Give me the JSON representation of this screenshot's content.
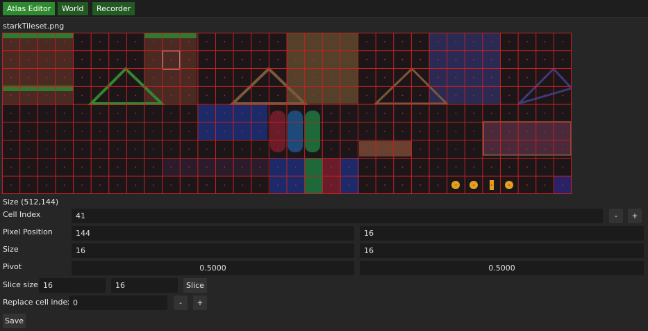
{
  "tabs": [
    {
      "label": "Atlas Editor",
      "active": true
    },
    {
      "label": "World",
      "active": false
    },
    {
      "label": "Recorder",
      "active": false
    }
  ],
  "atlas": {
    "filename": "starkTileset.png",
    "size_label": "Size (512,144)",
    "grid_color": "#c62020",
    "cols": 32,
    "rows": 9
  },
  "cell_index": {
    "label": "Cell Index",
    "value": "41",
    "decrement": "-",
    "increment": "+"
  },
  "pixel_position": {
    "label": "Pixel Position",
    "x": "144",
    "y": "16"
  },
  "size": {
    "label": "Size",
    "w": "16",
    "h": "16"
  },
  "pivot": {
    "label": "Pivot",
    "x": "0.5000",
    "y": "0.5000"
  },
  "slice": {
    "label": "Slice size",
    "w": "16",
    "h": "16",
    "button": "Slice"
  },
  "replace": {
    "label": "Replace cell index",
    "value": "0",
    "decrement": "-",
    "increment": "+"
  },
  "save_label": "Save"
}
